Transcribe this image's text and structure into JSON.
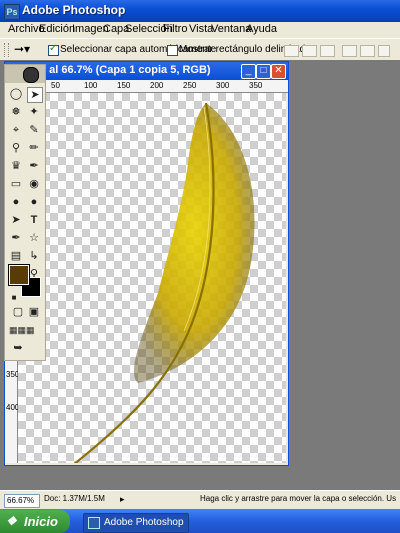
{
  "app": {
    "title": "Adobe Photoshop",
    "icon": "photoshop-icon"
  },
  "menubar": {
    "items": [
      "Archivo",
      "Edición",
      "Imagen",
      "Capa",
      "Selección",
      "Filtro",
      "Vista",
      "Ventana",
      "Ayuda"
    ]
  },
  "optionsbar": {
    "auto_select_label": "Seleccionar capa automáticamente",
    "auto_select_checked": true,
    "bounding_box_label": "Mostrar rectángulo delimitador",
    "bounding_box_checked": false
  },
  "document": {
    "title": "...tulo-1 al 66.7% (Capa 1 copia 5, RGB)",
    "ruler_top": [
      "0",
      "50",
      "100",
      "150",
      "200",
      "250",
      "300",
      "350",
      "400"
    ],
    "ruler_left": [
      "0",
      "50",
      "100",
      "150",
      "200",
      "250",
      "300",
      "350",
      "400"
    ]
  },
  "colors": {
    "foreground": "#5a3a06",
    "background": "#000000",
    "feather": "#d4b800"
  },
  "status": {
    "zoom": "66.67%",
    "doc_size": "Doc: 1.37M/1.5M",
    "hint": "Haga clic y arrastre para mover la capa o selección. Use Mayús. y Alt p"
  },
  "taskbar": {
    "start_label": "Inicio",
    "task_label": "Adobe Photoshop"
  }
}
